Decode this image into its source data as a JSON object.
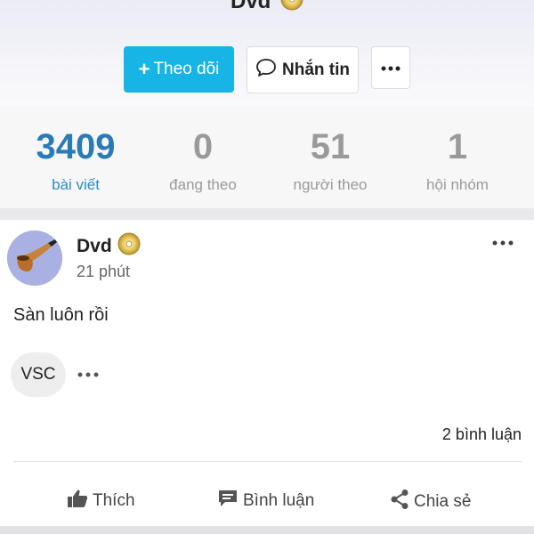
{
  "profile": {
    "name": "Dvd",
    "follow_label": "Theo dõi",
    "message_label": "Nhắn tin",
    "more_icon": "ellipsis-icon"
  },
  "stats": [
    {
      "value": "3409",
      "label": "bài viết",
      "active": true
    },
    {
      "value": "0",
      "label": "đang theo",
      "active": false
    },
    {
      "value": "51",
      "label": "người theo",
      "active": false
    },
    {
      "value": "1",
      "label": "hội nhóm",
      "active": false
    }
  ],
  "post": {
    "author": "Dvd",
    "time": "21 phút",
    "body": "Sàn luôn rồi",
    "chip": "VSC",
    "comments": "2 bình luận",
    "actions": {
      "like": "Thích",
      "comment": "Bình luận",
      "share": "Chia sẻ"
    }
  },
  "colors": {
    "accent": "#17b4e6",
    "active_stat": "#2a7bb5",
    "muted": "#9a9a9a"
  }
}
